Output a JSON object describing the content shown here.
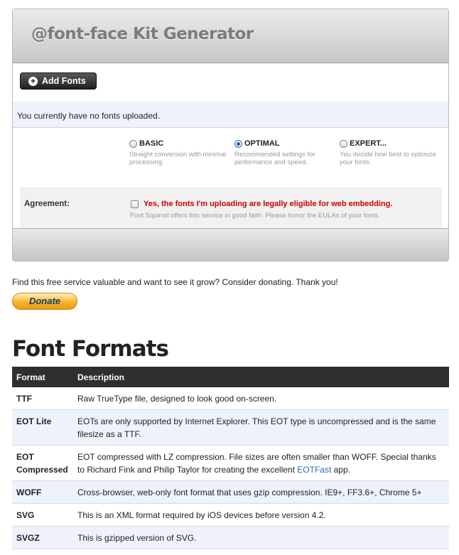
{
  "panel": {
    "title": "@font-face Kit Generator",
    "add_fonts_label": "Add Fonts",
    "status": "You currently have no fonts uploaded."
  },
  "options": [
    {
      "label": "BASIC",
      "description": "Straight conversion with minimal processing.",
      "selected": false
    },
    {
      "label": "OPTIMAL",
      "description": "Recommended settings for performance and speed.",
      "selected": true
    },
    {
      "label": "EXPERT...",
      "description": "You decide how best to optimize your fonts.",
      "selected": false
    }
  ],
  "agreement": {
    "label": "Agreement:",
    "checkbox_text": "Yes, the fonts I'm uploading are legally eligible for web embedding.",
    "note": "Font Squirrel offers this service in good faith. Please honor the EULAs of your fonts.",
    "checked": false
  },
  "donate": {
    "text": "Find this free service valuable and want to see it grow? Consider donating. Thank you!",
    "button_label": "Donate"
  },
  "formats_section": {
    "title": "Font Formats",
    "columns": [
      "Format",
      "Description"
    ],
    "rows": [
      {
        "format": "TTF",
        "description": "Raw TrueType file, designed to look good on-screen."
      },
      {
        "format": "EOT Lite",
        "description": "EOTs are only supported by Internet Explorer. This EOT type is uncompressed and is the same filesize as a TTF."
      },
      {
        "format": "EOT Compressed",
        "description_before": "EOT compressed with LZ compression. File sizes are often smaller than WOFF. Special thanks to Richard Fink and Philip Taylor for creating the excellent ",
        "link": "EOTFast",
        "description_after": " app."
      },
      {
        "format": "WOFF",
        "description": "Cross-browser, web-only font format that uses gzip compression. IE9+, FF3.6+, Chrome 5+"
      },
      {
        "format": "SVG",
        "description": "This is an XML format required by iOS devices before version 4.2."
      },
      {
        "format": "SVGZ",
        "description": "This is gzipped version of SVG."
      }
    ]
  },
  "colors": {
    "agreement_text": "#cc0000",
    "link": "#2a6ab6",
    "table_header_bg": "#2f2f2f",
    "alt_row_bg": "#eef3fb"
  }
}
